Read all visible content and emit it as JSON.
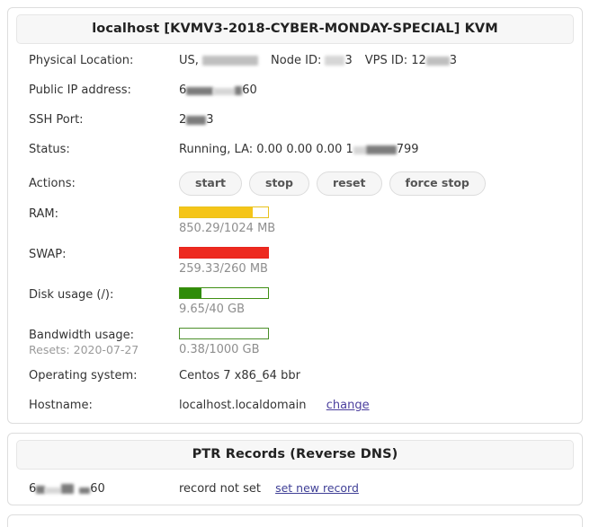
{
  "main_panel": {
    "header": {
      "hostname": "localhost",
      "plan": "[KVMV3-2018-CYBER-MONDAY-SPECIAL]",
      "virt": "KVM",
      "full": "localhost  [KVMV3-2018-CYBER-MONDAY-SPECIAL]  KVM"
    },
    "rows": {
      "physical_location": {
        "label": "Physical Location:",
        "value_prefix": "US, ",
        "value_region": "New Jersey",
        "node_id_label": "Node ID:",
        "node_id_value": "3",
        "vps_id_label": "VPS ID:",
        "vps_id_value_prefix": "12",
        "vps_id_value_suffix": "3"
      },
      "public_ip": {
        "label": "Public IP address:",
        "value_prefix": "6",
        "value_suffix": "60"
      },
      "ssh_port": {
        "label": "SSH Port:",
        "value_prefix": "2",
        "value_suffix": "3"
      },
      "status": {
        "label": "Status:",
        "value_prefix": "Running, LA: 0.00 0.00 0.00 1",
        "value_suffix": "799"
      },
      "actions": {
        "label": "Actions:",
        "buttons": [
          {
            "label": "start",
            "name": "start-button"
          },
          {
            "label": "stop",
            "name": "stop-button"
          },
          {
            "label": "reset",
            "name": "reset-button"
          },
          {
            "label": "force stop",
            "name": "force-stop-button"
          }
        ]
      },
      "ram": {
        "label": "RAM:",
        "text": "850.29/1024 MB",
        "used": 850.29,
        "total": 1024,
        "unit": "MB",
        "percent": 83,
        "color": "#f5c518"
      },
      "swap": {
        "label": "SWAP:",
        "text": "259.33/260 MB",
        "used": 259.33,
        "total": 260,
        "unit": "MB",
        "percent": 100,
        "color": "#ed2a1f"
      },
      "disk": {
        "label": "Disk usage (/):",
        "text": "9.65/40 GB",
        "used": 9.65,
        "total": 40,
        "unit": "GB",
        "percent": 24,
        "color": "#2f8c08"
      },
      "bandwidth": {
        "label": "Bandwidth usage:",
        "sub_label": "Resets: 2020-07-27",
        "text": "0.38/1000 GB",
        "used": 0.38,
        "total": 1000,
        "unit": "GB",
        "percent": 0,
        "color": "#4b8f2a"
      },
      "operating_system": {
        "label": "Operating system:",
        "value": "Centos 7 x86_64 bbr"
      },
      "hostname": {
        "label": "Hostname:",
        "value": "localhost.localdomain",
        "change_link": "change"
      }
    }
  },
  "ptr_panel": {
    "header": "PTR Records (Reverse DNS)",
    "record": {
      "ip_prefix": "6",
      "ip_suffix": "60",
      "status": "record not set",
      "action_link": "set new record"
    }
  }
}
